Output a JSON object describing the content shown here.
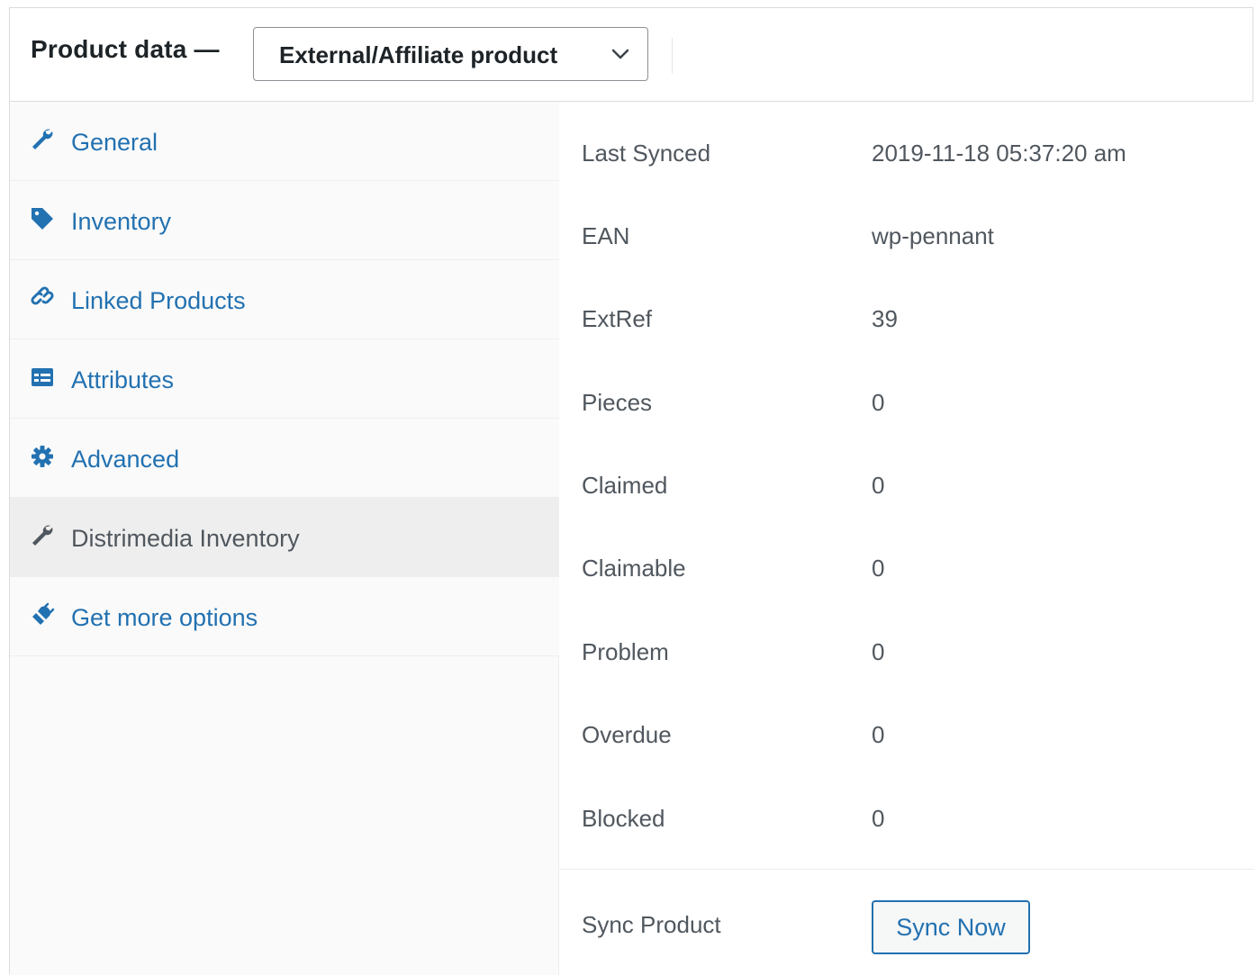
{
  "header": {
    "title": "Product data —",
    "product_type": "External/Affiliate product"
  },
  "colors": {
    "link": "#2271b1",
    "active_tab_bg": "#eeeeee",
    "text_muted": "#50575e"
  },
  "tabs": [
    {
      "label": "General",
      "icon": "wrench-icon",
      "active": false
    },
    {
      "label": "Inventory",
      "icon": "tag-icon",
      "active": false
    },
    {
      "label": "Linked Products",
      "icon": "link-icon",
      "active": false
    },
    {
      "label": "Attributes",
      "icon": "list-table-icon",
      "active": false
    },
    {
      "label": "Advanced",
      "icon": "gear-icon",
      "active": false
    },
    {
      "label": "Distrimedia Inventory",
      "icon": "wrench-icon",
      "active": true
    },
    {
      "label": "Get more options",
      "icon": "plugin-icon",
      "active": false
    }
  ],
  "fields": [
    {
      "label": "Last Synced",
      "value": "2019-11-18 05:37:20 am"
    },
    {
      "label": "EAN",
      "value": "wp-pennant"
    },
    {
      "label": "ExtRef",
      "value": "39"
    },
    {
      "label": "Pieces",
      "value": "0"
    },
    {
      "label": "Claimed",
      "value": "0"
    },
    {
      "label": "Claimable",
      "value": "0"
    },
    {
      "label": "Problem",
      "value": "0"
    },
    {
      "label": "Overdue",
      "value": "0"
    },
    {
      "label": "Blocked",
      "value": "0"
    }
  ],
  "sync": {
    "label": "Sync Product",
    "button_label": "Sync Now"
  }
}
